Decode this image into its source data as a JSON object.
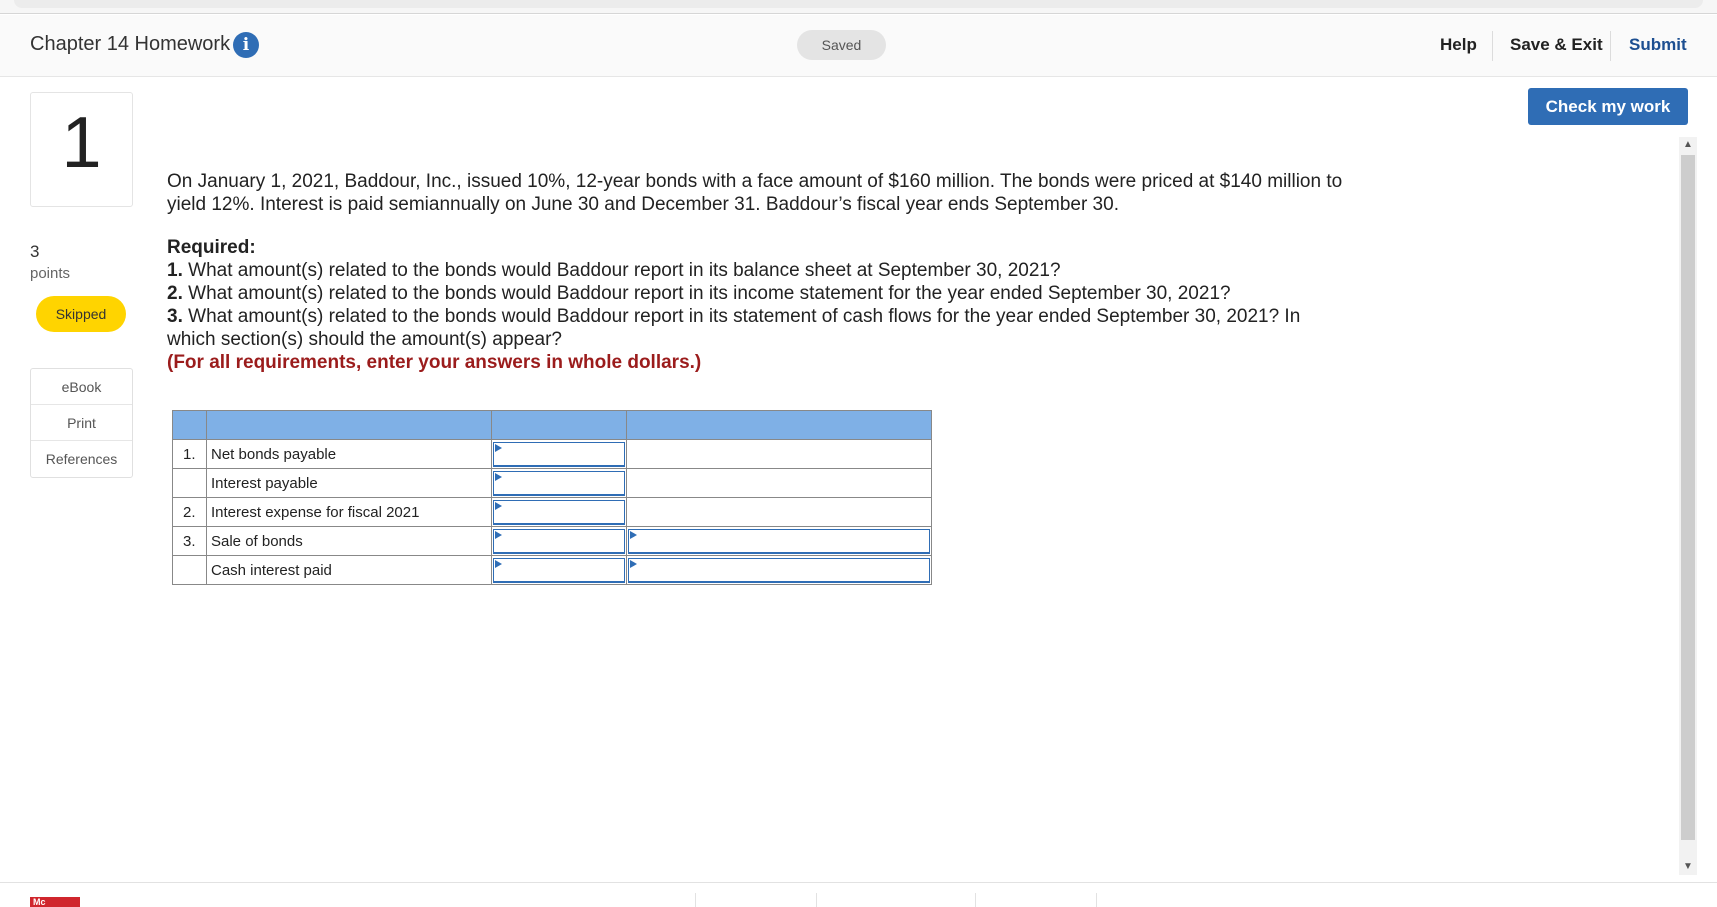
{
  "header": {
    "title": "Chapter 14 Homework",
    "info_icon": "info-icon",
    "saved_label": "Saved",
    "help_label": "Help",
    "save_exit_label": "Save & Exit",
    "submit_label": "Submit"
  },
  "question": {
    "number": "1",
    "points_value": "3",
    "points_label": "points",
    "status": "Skipped"
  },
  "side_menu": {
    "items": [
      "eBook",
      "Print",
      "References"
    ]
  },
  "check_button_label": "Check my work",
  "content": {
    "intro": "On January 1, 2021, Baddour, Inc., issued 10%, 12-year bonds with a face amount of $160 million. The bonds were priced at $140 million to yield 12%. Interest is paid semiannually on June 30 and December 31. Baddour’s fiscal year ends September 30.",
    "required_label": "Required:",
    "req1_num": "1.",
    "req1_text": " What amount(s) related to the bonds would Baddour report in its balance sheet at September 30, 2021?",
    "req2_num": "2.",
    "req2_text": " What amount(s) related to the bonds would Baddour report in its income statement for the year ended September 30, 2021?",
    "req3_num": "3.",
    "req3_text": " What amount(s) related to the bonds would Baddour report in its statement of cash flows for the year ended September 30, 2021? In which section(s) should the amount(s) appear?",
    "note": "(For all requirements, enter your answers in whole dollars.)"
  },
  "table": {
    "rows": [
      {
        "num": "1.",
        "label": "Net bonds payable",
        "amount": "",
        "section": ""
      },
      {
        "num": "",
        "label": "Interest payable",
        "amount": "",
        "section": ""
      },
      {
        "num": "2.",
        "label": "Interest expense for fiscal 2021",
        "amount": "",
        "section": ""
      },
      {
        "num": "3.",
        "label": "Sale of bonds",
        "amount": "",
        "section": ""
      },
      {
        "num": "",
        "label": "Cash interest paid",
        "amount": "",
        "section": ""
      }
    ]
  },
  "footer": {
    "logo_text": "Mc"
  }
}
